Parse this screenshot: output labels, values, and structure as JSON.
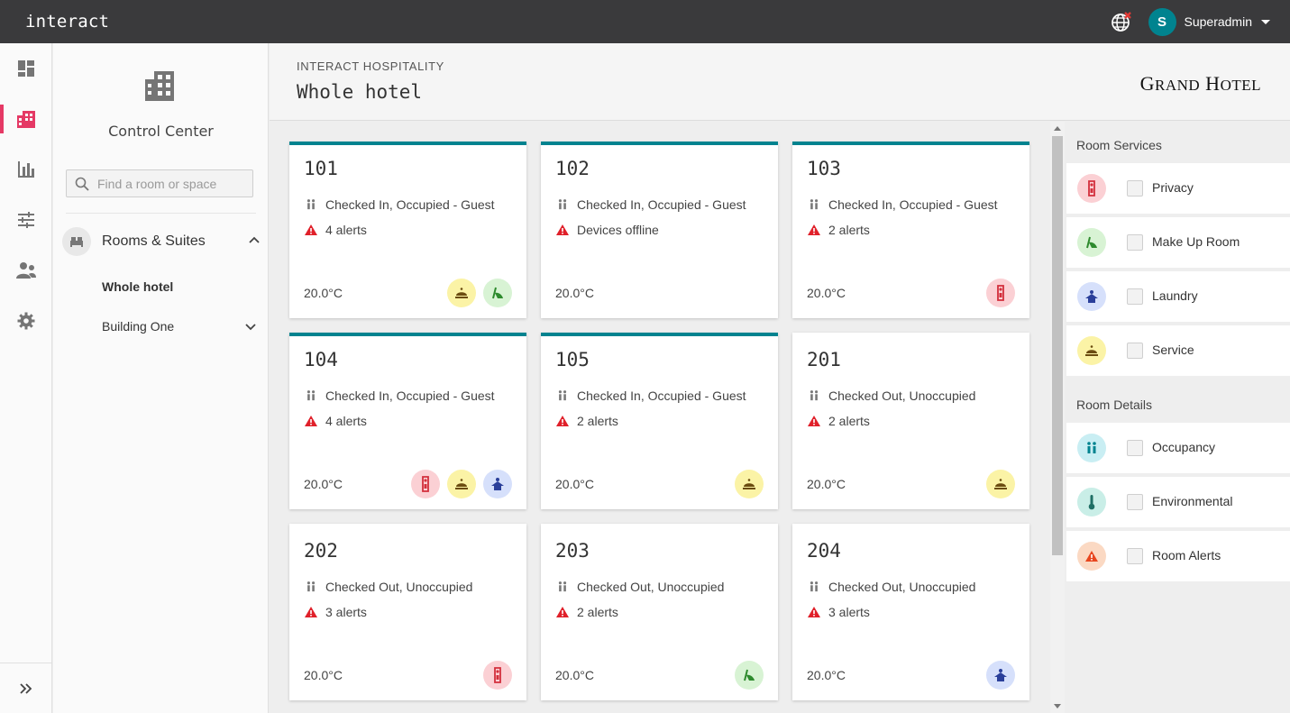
{
  "app": {
    "brand": "interact",
    "user": {
      "initial": "S",
      "name": "Superadmin"
    }
  },
  "sidebar": {
    "title": "Control Center",
    "search_placeholder": "Find a room or space",
    "section_label": "Rooms & Suites",
    "items": [
      {
        "label": "Whole hotel",
        "active": true
      },
      {
        "label": "Building One",
        "active": false
      }
    ]
  },
  "header": {
    "breadcrumb": "INTERACT HOSPITALITY",
    "title": "Whole hotel",
    "logo": {
      "big1": "G",
      "small1": "RAND",
      "big2": "H",
      "small2": "OTEL"
    }
  },
  "colors": {
    "accent": "#00838f",
    "rail_active": "#e53965",
    "alert": "#e0202a",
    "privacy_bg": "#fbd0d4",
    "privacy_fg": "#d32f3c",
    "makeup_bg": "#d8f3d4",
    "makeup_fg": "#2e8b2e",
    "laundry_bg": "#d6e0fb",
    "laundry_fg": "#2a3f9a",
    "service_bg": "#fbf3a6",
    "service_fg": "#6b4c10"
  },
  "rooms": [
    {
      "number": "101",
      "status": "Checked In, Occupied - Guest",
      "alert": "4 alerts",
      "temp": "20.0°C",
      "badges": [
        "service",
        "makeup"
      ],
      "topline": true
    },
    {
      "number": "102",
      "status": "Checked In, Occupied - Guest",
      "alert": "Devices offline",
      "temp": "20.0°C",
      "badges": [],
      "topline": true
    },
    {
      "number": "103",
      "status": "Checked In, Occupied - Guest",
      "alert": "2 alerts",
      "temp": "20.0°C",
      "badges": [
        "privacy"
      ],
      "topline": true
    },
    {
      "number": "104",
      "status": "Checked In, Occupied - Guest",
      "alert": "4 alerts",
      "temp": "20.0°C",
      "badges": [
        "privacy",
        "service",
        "laundry"
      ],
      "topline": true
    },
    {
      "number": "105",
      "status": "Checked In, Occupied - Guest",
      "alert": "2 alerts",
      "temp": "20.0°C",
      "badges": [
        "service"
      ],
      "topline": true
    },
    {
      "number": "201",
      "status": "Checked Out, Unoccupied",
      "alert": "2 alerts",
      "temp": "20.0°C",
      "badges": [
        "service"
      ],
      "topline": false
    },
    {
      "number": "202",
      "status": "Checked Out, Unoccupied",
      "alert": "3 alerts",
      "temp": "20.0°C",
      "badges": [
        "privacy"
      ],
      "topline": false
    },
    {
      "number": "203",
      "status": "Checked Out, Unoccupied",
      "alert": "2 alerts",
      "temp": "20.0°C",
      "badges": [
        "makeup"
      ],
      "topline": false
    },
    {
      "number": "204",
      "status": "Checked Out, Unoccupied",
      "alert": "3 alerts",
      "temp": "20.0°C",
      "badges": [
        "laundry"
      ],
      "topline": false
    }
  ],
  "right_panel": {
    "services_heading": "Room Services",
    "services": [
      {
        "label": "Privacy",
        "icon": "privacy-icon"
      },
      {
        "label": "Make Up Room",
        "icon": "makeup-icon"
      },
      {
        "label": "Laundry",
        "icon": "laundry-icon"
      },
      {
        "label": "Service",
        "icon": "service-bell-icon"
      }
    ],
    "details_heading": "Room Details",
    "details": [
      {
        "label": "Occupancy",
        "icon": "occupancy-icon"
      },
      {
        "label": "Environmental",
        "icon": "thermometer-icon"
      },
      {
        "label": "Room Alerts",
        "icon": "warning-icon"
      }
    ]
  }
}
